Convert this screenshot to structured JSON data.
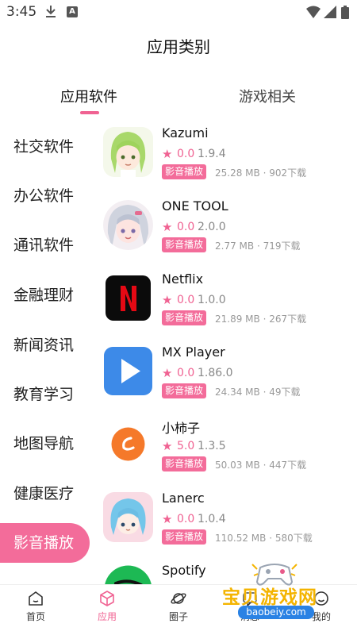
{
  "status": {
    "time": "3:45",
    "a_badge": "A"
  },
  "page_title": "应用类别",
  "tabs": [
    {
      "label": "应用软件",
      "active": true
    },
    {
      "label": "游戏相关",
      "active": false
    }
  ],
  "sidebar": {
    "items": [
      {
        "label": "社交软件"
      },
      {
        "label": "办公软件"
      },
      {
        "label": "通讯软件"
      },
      {
        "label": "金融理财"
      },
      {
        "label": "新闻资讯"
      },
      {
        "label": "教育学习"
      },
      {
        "label": "地图导航"
      },
      {
        "label": "健康医疗"
      },
      {
        "label": "影音播放",
        "active": true
      }
    ]
  },
  "apps": [
    {
      "name": "Kazumi",
      "rating": "0.0",
      "version": "1.9.4",
      "tag": "影音播放",
      "size": "25.28 MB",
      "downloads": "902下载",
      "icon": "anime-girl-icon"
    },
    {
      "name": "ONE TOOL",
      "rating": "0.0",
      "version": "2.0.0",
      "tag": "影音播放",
      "size": "2.77 MB",
      "downloads": "719下载",
      "icon": "anime-avatar-icon"
    },
    {
      "name": "Netflix",
      "rating": "0.0",
      "version": "1.0.0",
      "tag": "影音播放",
      "size": "21.89 MB",
      "downloads": "267下载",
      "icon": "netflix-icon"
    },
    {
      "name": "MX Player",
      "rating": "0.0",
      "version": "1.86.0",
      "tag": "影音播放",
      "size": "24.34 MB",
      "downloads": "49下载",
      "icon": "play-icon"
    },
    {
      "name": "小柿子",
      "rating": "5.0",
      "version": "1.3.5",
      "tag": "影音播放",
      "size": "50.03 MB",
      "downloads": "447下载",
      "icon": "persimmon-icon"
    },
    {
      "name": "Lanerc",
      "rating": "0.0",
      "version": "1.0.4",
      "tag": "影音播放",
      "size": "110.52 MB",
      "downloads": "580下载",
      "icon": "chibi-icon"
    },
    {
      "name": "Spotify",
      "icon": "spotify-icon"
    }
  ],
  "meta_separator": " · ",
  "bottom_nav": [
    {
      "label": "首页",
      "icon": "home-icon"
    },
    {
      "label": "应用",
      "icon": "cube-icon",
      "active": true
    },
    {
      "label": "圈子",
      "icon": "planet-icon"
    },
    {
      "label": "消息",
      "icon": "message-icon"
    },
    {
      "label": "我的",
      "icon": "profile-icon"
    }
  ],
  "watermark": {
    "title": "宝贝游戏网",
    "url": "baobeiy.com"
  },
  "colors": {
    "accent": "#f36c9a",
    "text": "#222222",
    "muted": "#999999"
  }
}
